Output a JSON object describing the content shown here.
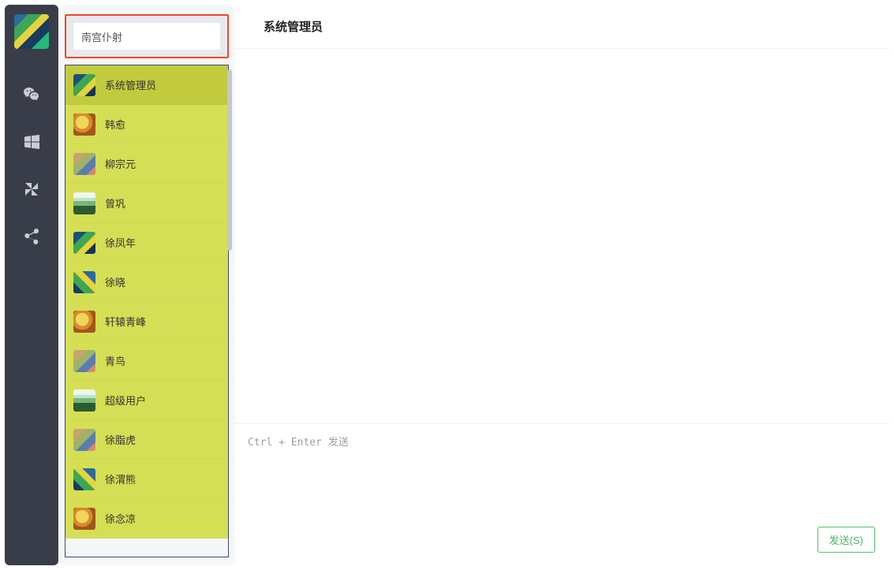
{
  "search": {
    "value": "南宫仆射"
  },
  "contacts": [
    {
      "name": "系统管理员",
      "thumb": "set1",
      "active": true
    },
    {
      "name": "韩愈",
      "thumb": "set2",
      "active": false
    },
    {
      "name": "柳宗元",
      "thumb": "set4",
      "active": false
    },
    {
      "name": "曾巩",
      "thumb": "set3",
      "active": false
    },
    {
      "name": "徐凤年",
      "thumb": "set1",
      "active": false
    },
    {
      "name": "徐晓",
      "thumb": "set5",
      "active": false
    },
    {
      "name": "轩辕青峰",
      "thumb": "set2",
      "active": false
    },
    {
      "name": "青鸟",
      "thumb": "set4",
      "active": false
    },
    {
      "name": "超级用户",
      "thumb": "set3",
      "active": false
    },
    {
      "name": "徐脂虎",
      "thumb": "set4",
      "active": false
    },
    {
      "name": "徐渭熊",
      "thumb": "set5",
      "active": false
    },
    {
      "name": "徐念凉",
      "thumb": "set2",
      "active": false
    }
  ],
  "chat": {
    "title": "系统管理员",
    "input_placeholder": "Ctrl + Enter 发送",
    "send_label": "发送(S)"
  },
  "nav": {
    "icons": [
      "wechat-icon",
      "windows-icon",
      "pinwheel-icon",
      "share-icon"
    ]
  }
}
